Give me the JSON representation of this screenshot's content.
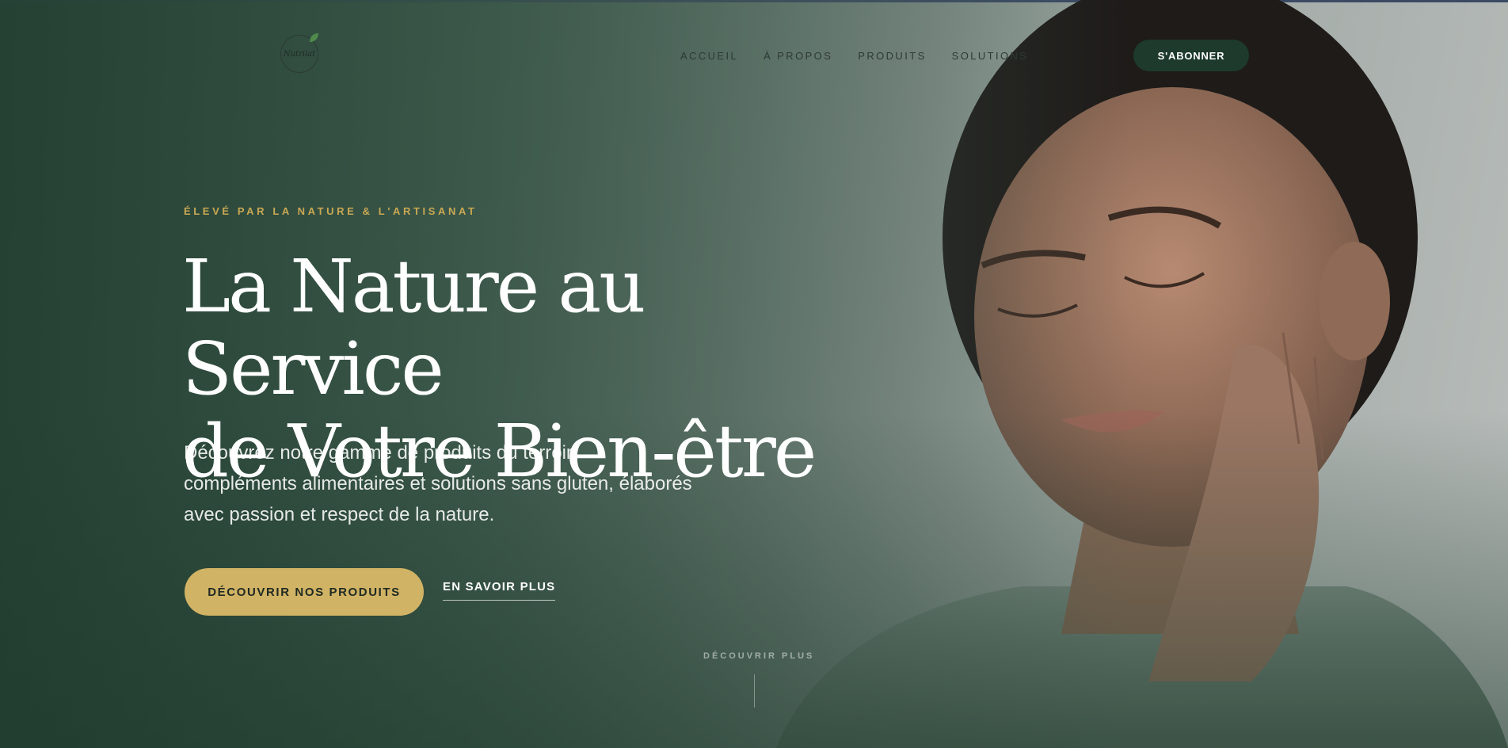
{
  "brand": {
    "logo_text": "Nutrilat"
  },
  "nav": {
    "items": [
      "ACCUEIL",
      "À PROPOS",
      "PRODUITS",
      "SOLUTIONS"
    ],
    "subscribe_label": "S'ABONNER"
  },
  "hero": {
    "eyebrow": "ÉLEVÉ PAR LA NATURE & L'ARTISANAT",
    "headline_line1": "La Nature au Service",
    "headline_line2": "de Votre Bien-être",
    "description_line1": "Découvrez notre gamme de produits du terroir,",
    "description_line2": "compléments alimentaires et solutions sans gluten, élaborés",
    "description_line3": "avec passion et respect de la nature.",
    "primary_cta": "DÉCOUVRIR NOS PRODUITS",
    "secondary_cta": "EN SAVOIR PLUS",
    "scroll_label": "DÉCOUVRIR PLUS"
  },
  "colors": {
    "accent_gold": "#d1b365",
    "dark_green": "#1d3a2c",
    "eyebrow_gold": "#c9a853"
  },
  "icons": {
    "logo_leaf": "leaf-icon"
  }
}
